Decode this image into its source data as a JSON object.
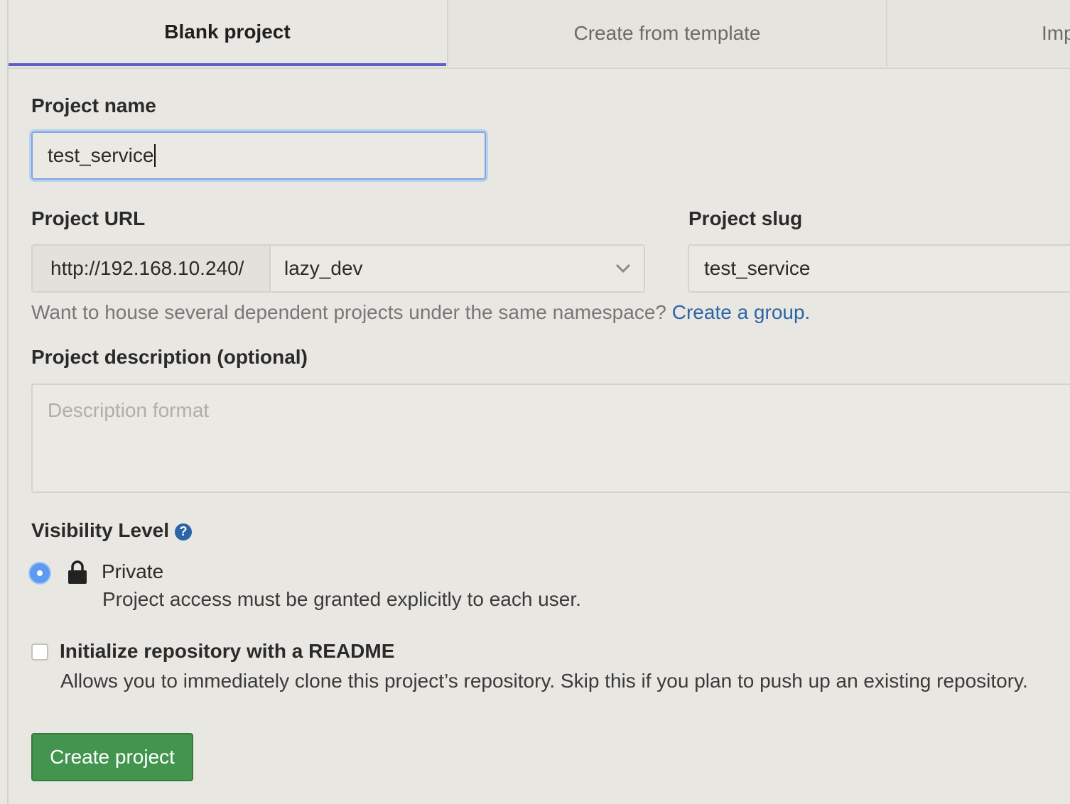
{
  "tabs": [
    {
      "label": "Blank project",
      "active": true
    },
    {
      "label": "Create from template",
      "active": false
    },
    {
      "label": "Imp",
      "active": false
    }
  ],
  "form": {
    "project_name": {
      "label": "Project name",
      "value": "test_service"
    },
    "project_url": {
      "label": "Project URL",
      "prefix": "http://192.168.10.240/",
      "namespace": "lazy_dev"
    },
    "project_slug": {
      "label": "Project slug",
      "value": "test_service"
    },
    "namespace_hint": {
      "text": "Want to house several dependent projects under the same namespace?",
      "link": "Create a group."
    },
    "description": {
      "label": "Project description (optional)",
      "placeholder": "Description format"
    },
    "visibility": {
      "label": "Visibility Level",
      "help_icon": "?",
      "options": [
        {
          "label": "Private",
          "description": "Project access must be granted explicitly to each user.",
          "selected": true
        }
      ]
    },
    "readme": {
      "label": "Initialize repository with a README",
      "description": "Allows you to immediately clone this project’s repository. Skip this if you plan to push up an existing repository.",
      "checked": false
    },
    "submit_label": "Create project"
  },
  "colors": {
    "accent": "#5c5fc7",
    "submit": "#43944f",
    "link": "#2c64a8",
    "radio": "#5b9cf0"
  }
}
